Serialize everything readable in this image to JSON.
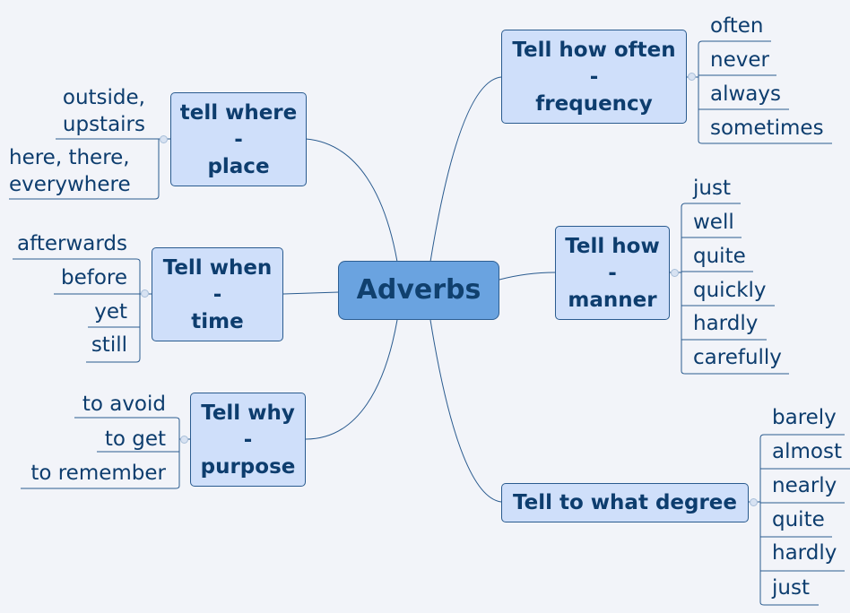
{
  "central": "Adverbs",
  "colors": {
    "background": "#f2f4f9",
    "topic_fill": "#cfdffa",
    "central_fill": "#6aa3e0",
    "text": "#0d3d6e",
    "line": "#2a5b8f"
  },
  "topics": {
    "where": {
      "lines": [
        "tell where",
        "-",
        "place"
      ],
      "items": [
        "outside,\nupstairs",
        "here, there,\neverywhere"
      ]
    },
    "when": {
      "lines": [
        "Tell when",
        "-",
        "time"
      ],
      "items": [
        "afterwards",
        "before",
        "yet",
        "still"
      ]
    },
    "why": {
      "lines": [
        "Tell why",
        "-",
        "purpose"
      ],
      "items": [
        "to avoid",
        "to get",
        "to remember"
      ]
    },
    "often": {
      "lines": [
        "Tell how often",
        "-",
        "frequency"
      ],
      "items": [
        "often",
        "never",
        "always",
        "sometimes"
      ]
    },
    "how": {
      "lines": [
        "Tell how",
        "-",
        "manner"
      ],
      "items": [
        "just",
        "well",
        "quite",
        "quickly",
        "hardly",
        "carefully"
      ]
    },
    "degree": {
      "lines": [
        "Tell to what degree"
      ],
      "items": [
        "barely",
        "almost",
        "nearly",
        "quite",
        "hardly",
        "just"
      ]
    }
  }
}
